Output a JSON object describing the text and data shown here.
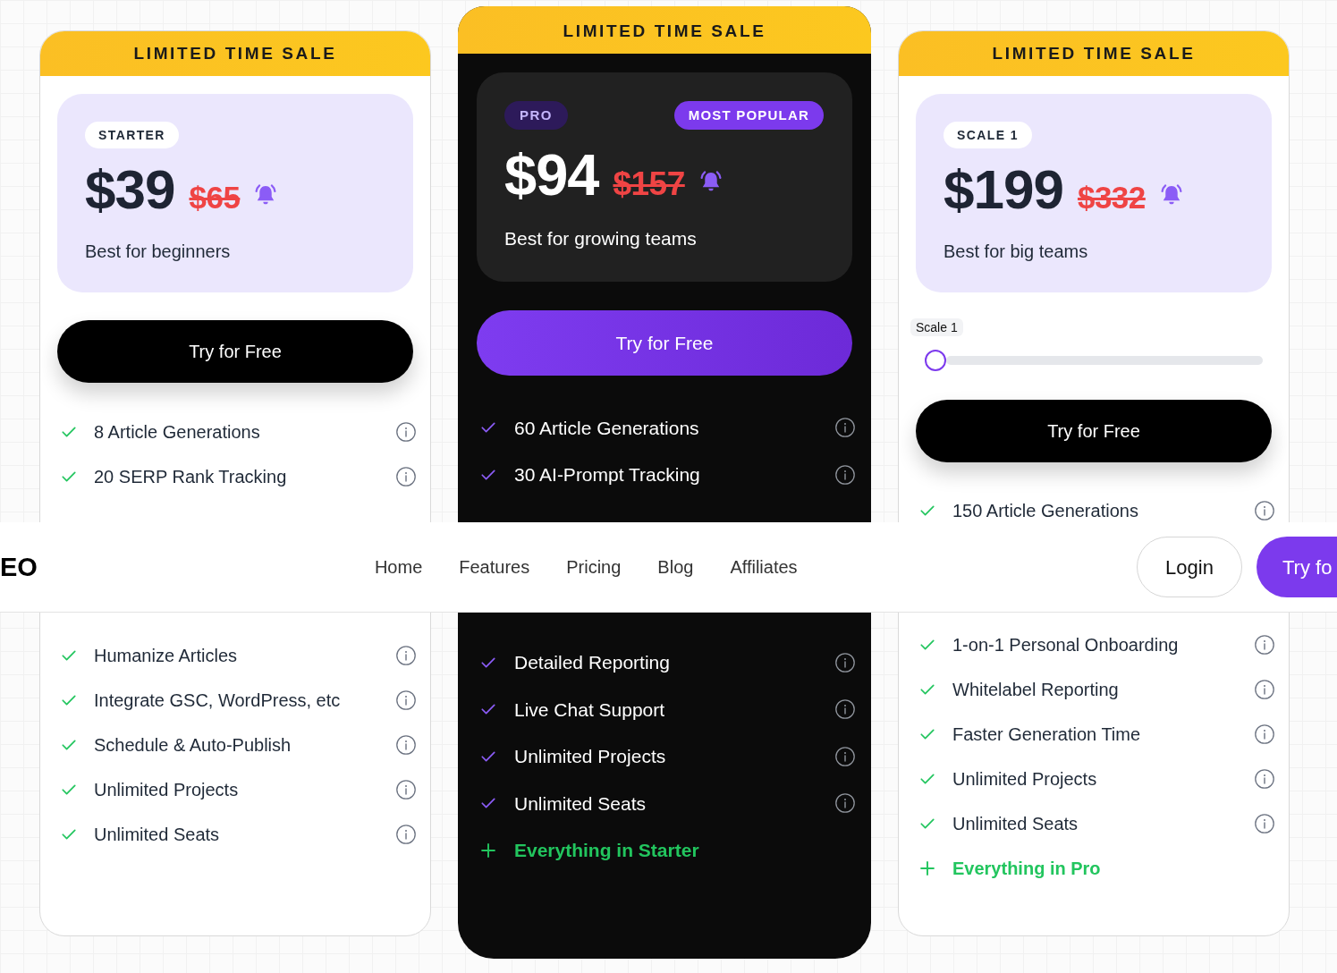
{
  "plans": [
    {
      "kind": "standard",
      "sale_banner": "LIMITED TIME SALE",
      "badge": "STARTER",
      "price": "$39",
      "original_price": "$65",
      "description": "Best for beginners",
      "cta": "Try for Free",
      "features_top": [
        {
          "kind": "included",
          "text": "8 Article Generations"
        },
        {
          "kind": "included",
          "text": "20 SERP Rank Tracking"
        }
      ],
      "features_bottom": [
        {
          "kind": "included",
          "text": "Humanize Articles"
        },
        {
          "kind": "included",
          "text": "Integrate GSC, WordPress, etc"
        },
        {
          "kind": "included",
          "text": "Schedule & Auto-Publish"
        },
        {
          "kind": "included",
          "text": "Unlimited Projects"
        },
        {
          "kind": "included",
          "text": "Unlimited Seats"
        }
      ]
    },
    {
      "kind": "featured",
      "sale_banner": "LIMITED TIME SALE",
      "badge": "PRO",
      "popular_badge": "MOST POPULAR",
      "price": "$94",
      "original_price": "$157",
      "description": "Best for growing teams",
      "cta": "Try for Free",
      "features_top": [
        {
          "kind": "included",
          "text": "60 Article Generations"
        },
        {
          "kind": "included",
          "text": "30 AI-Prompt Tracking"
        }
      ],
      "features_bottom": [
        {
          "kind": "included",
          "text": "Detailed Reporting"
        },
        {
          "kind": "included",
          "text": "Live Chat Support"
        },
        {
          "kind": "included",
          "text": "Unlimited Projects"
        },
        {
          "kind": "included",
          "text": "Unlimited Seats"
        },
        {
          "kind": "bundle",
          "text": "Everything in Starter"
        }
      ]
    },
    {
      "kind": "standard",
      "sale_banner": "LIMITED TIME SALE",
      "badge": "SCALE 1",
      "price": "$199",
      "original_price": "$332",
      "description": "Best for big teams",
      "slider": {
        "label": "Scale 1",
        "level": 0
      },
      "cta": "Try for Free",
      "features_top": [
        {
          "kind": "included",
          "text": "150 Article Generations"
        }
      ],
      "features_bottom": [
        {
          "kind": "included",
          "text": "1-on-1 Personal Onboarding"
        },
        {
          "kind": "included",
          "text": "Whitelabel Reporting"
        },
        {
          "kind": "included",
          "text": "Faster Generation Time"
        },
        {
          "kind": "included",
          "text": "Unlimited Projects"
        },
        {
          "kind": "included",
          "text": "Unlimited Seats"
        },
        {
          "kind": "bundle",
          "text": "Everything in Pro"
        }
      ]
    }
  ],
  "navbar": {
    "logo": "EO",
    "links": [
      "Home",
      "Features",
      "Pricing",
      "Blog",
      "Affiliates"
    ],
    "login": "Login",
    "cta": "Try fo"
  }
}
